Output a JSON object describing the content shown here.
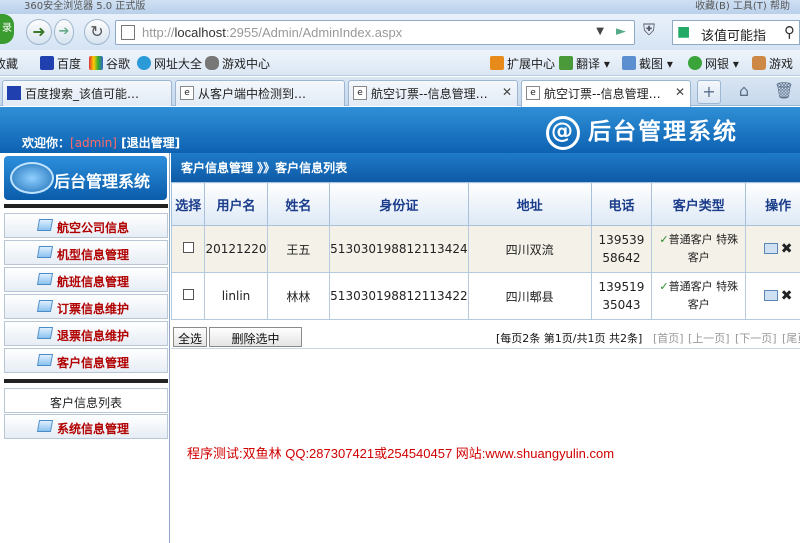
{
  "browser": {
    "title": "360安全浏览器 5.0 正式版",
    "title_right": "收藏(B)  工具(T)  帮助",
    "logo_text": "录",
    "address": {
      "prefix": "http://",
      "host": "localhost",
      "rest": ":2955/Admin/AdminIndex.aspx"
    },
    "search_text": "该值可能指"
  },
  "favorites": [
    {
      "label": "收藏",
      "icon": "star-icon"
    },
    {
      "label": "百度",
      "icon": "baidu-icon"
    },
    {
      "label": "谷歌",
      "icon": "google-icon"
    },
    {
      "label": "网址大全",
      "icon": "globe-icon"
    },
    {
      "label": "游戏中心",
      "icon": "gamepad-icon"
    }
  ],
  "toolbar_right": [
    {
      "label": "扩展中心"
    },
    {
      "label": "翻译"
    },
    {
      "label": "截图"
    },
    {
      "label": "网银"
    },
    {
      "label": "游戏"
    }
  ],
  "tabs": [
    {
      "label": "百度搜索_该值可能指..."
    },
    {
      "label": "从客户端中检测到有潜..."
    },
    {
      "label": "航空订票--信息管理平台"
    },
    {
      "label": "航空订票--信息管理平台"
    }
  ],
  "app": {
    "welcome_label": "欢迎你：",
    "username": "[admin]",
    "logout": "[退出管理]",
    "brand_title": "后台管理系统",
    "brand_symbol": "@"
  },
  "sidebar": {
    "logo_text": "后台管理系统",
    "items": [
      {
        "label": "航空公司信息"
      },
      {
        "label": "机型信息管理"
      },
      {
        "label": "航班信息管理"
      },
      {
        "label": "订票信息维护"
      },
      {
        "label": "退票信息维护"
      },
      {
        "label": "客户信息管理"
      }
    ],
    "sub_item": "客户信息列表",
    "system_item": "系统信息管理"
  },
  "breadcrumb": {
    "text": "客户信息管理 》》客户信息列表"
  },
  "table": {
    "headers": [
      "选择",
      "用户名",
      "姓名",
      "身份证",
      "地址",
      "电话",
      "客户类型",
      "操作"
    ],
    "rows": [
      {
        "username": "20121220",
        "name": "王五",
        "id": "513030198812113424",
        "address": "四川双流",
        "phone": "13953958642",
        "type": "普通客户 特殊客户"
      },
      {
        "username": "linlin",
        "name": "林林",
        "id": "513030198812113422",
        "address": "四川郫县",
        "phone": "13951935043",
        "type": "普通客户 特殊客户"
      }
    ]
  },
  "pager": {
    "select_all": "全选",
    "delete_selected": "删除选中",
    "info": "[每页2条 第1页/共1页 共2条]",
    "first": "[首页]",
    "prev": "[上一页]",
    "next": "[下一页]",
    "last": "[尾页]"
  },
  "footer": "程序测试:双鱼林  QQ:287307421或254540457 网站:www.shuangyulin.com",
  "colors": {
    "header_blue": "#0d62b2",
    "menu_red": "#b10000",
    "footer_red": "#d00000"
  }
}
